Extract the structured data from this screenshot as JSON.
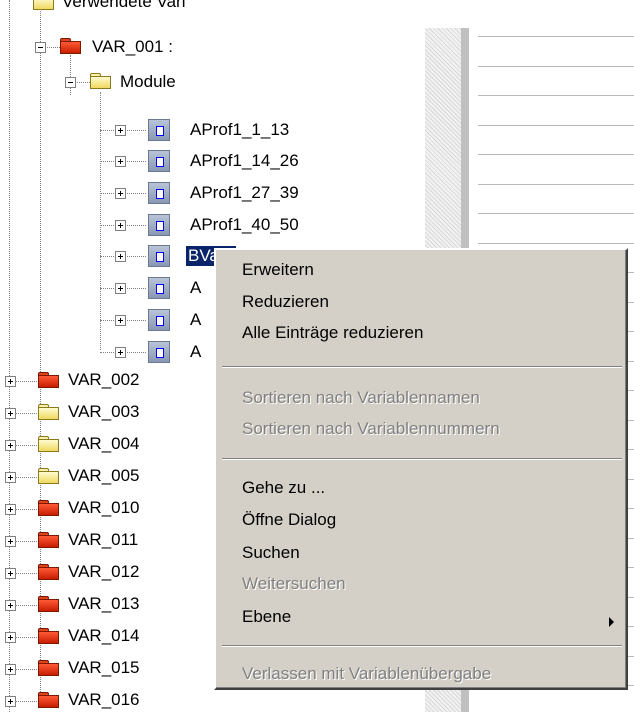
{
  "tree": {
    "root_label": "Verwendete Vari",
    "var001": {
      "label": "VAR_001 :"
    },
    "module_folder": {
      "label": "Module"
    },
    "modules": [
      "AProf1_1_13",
      "AProf1_14_26",
      "AProf1_27_39",
      "AProf1_40_50",
      "BVar1",
      "A",
      "A",
      "A"
    ],
    "vars": [
      {
        "label": "VAR_002",
        "color": "red"
      },
      {
        "label": "VAR_003",
        "color": "yellow"
      },
      {
        "label": "VAR_004",
        "color": "yellow"
      },
      {
        "label": "VAR_005",
        "color": "yellow"
      },
      {
        "label": "VAR_010",
        "color": "red"
      },
      {
        "label": "VAR_011",
        "color": "red"
      },
      {
        "label": "VAR_012",
        "color": "red"
      },
      {
        "label": "VAR_013",
        "color": "red"
      },
      {
        "label": "VAR_014",
        "color": "red"
      },
      {
        "label": "VAR_015",
        "color": "red"
      },
      {
        "label": "VAR_016",
        "color": "red"
      }
    ]
  },
  "context_menu": {
    "items": [
      {
        "label": "Erweitern",
        "enabled": true
      },
      {
        "label": "Reduzieren",
        "enabled": true
      },
      {
        "label": "Alle Einträge reduzieren",
        "enabled": true
      },
      {
        "label": "Sortieren nach Variablennamen",
        "enabled": false
      },
      {
        "label": "Sortieren nach Variablennummern",
        "enabled": false
      },
      {
        "label": "Gehe zu ...",
        "enabled": true
      },
      {
        "label": "Öffne Dialog",
        "enabled": true
      },
      {
        "label": "Suchen",
        "enabled": true
      },
      {
        "label": "Weitersuchen",
        "enabled": false
      },
      {
        "label": "Ebene",
        "enabled": true,
        "submenu": true
      },
      {
        "label": "Verlassen mit Variablenübergabe",
        "enabled": false
      }
    ]
  },
  "colors": {
    "selection": "#0a246a",
    "menu_bg": "#d4d0c8",
    "folder_red": "#e83010",
    "folder_yellow": "#f8e890"
  }
}
